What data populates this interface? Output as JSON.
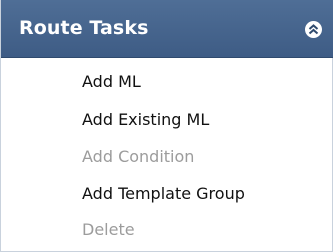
{
  "panel": {
    "title": "Route Tasks",
    "collapse_icon": "double-chevron-up-icon",
    "header_color": "#44638c"
  },
  "menu": {
    "items": [
      {
        "label": "Add ML",
        "enabled": true
      },
      {
        "label": "Add Existing ML",
        "enabled": true
      },
      {
        "label": "Add Condition",
        "enabled": false
      },
      {
        "label": "Add Template Group",
        "enabled": true
      },
      {
        "label": "Delete",
        "enabled": false
      }
    ]
  },
  "colors": {
    "enabled_text": "#111111",
    "disabled_text": "#9c9c9c"
  }
}
